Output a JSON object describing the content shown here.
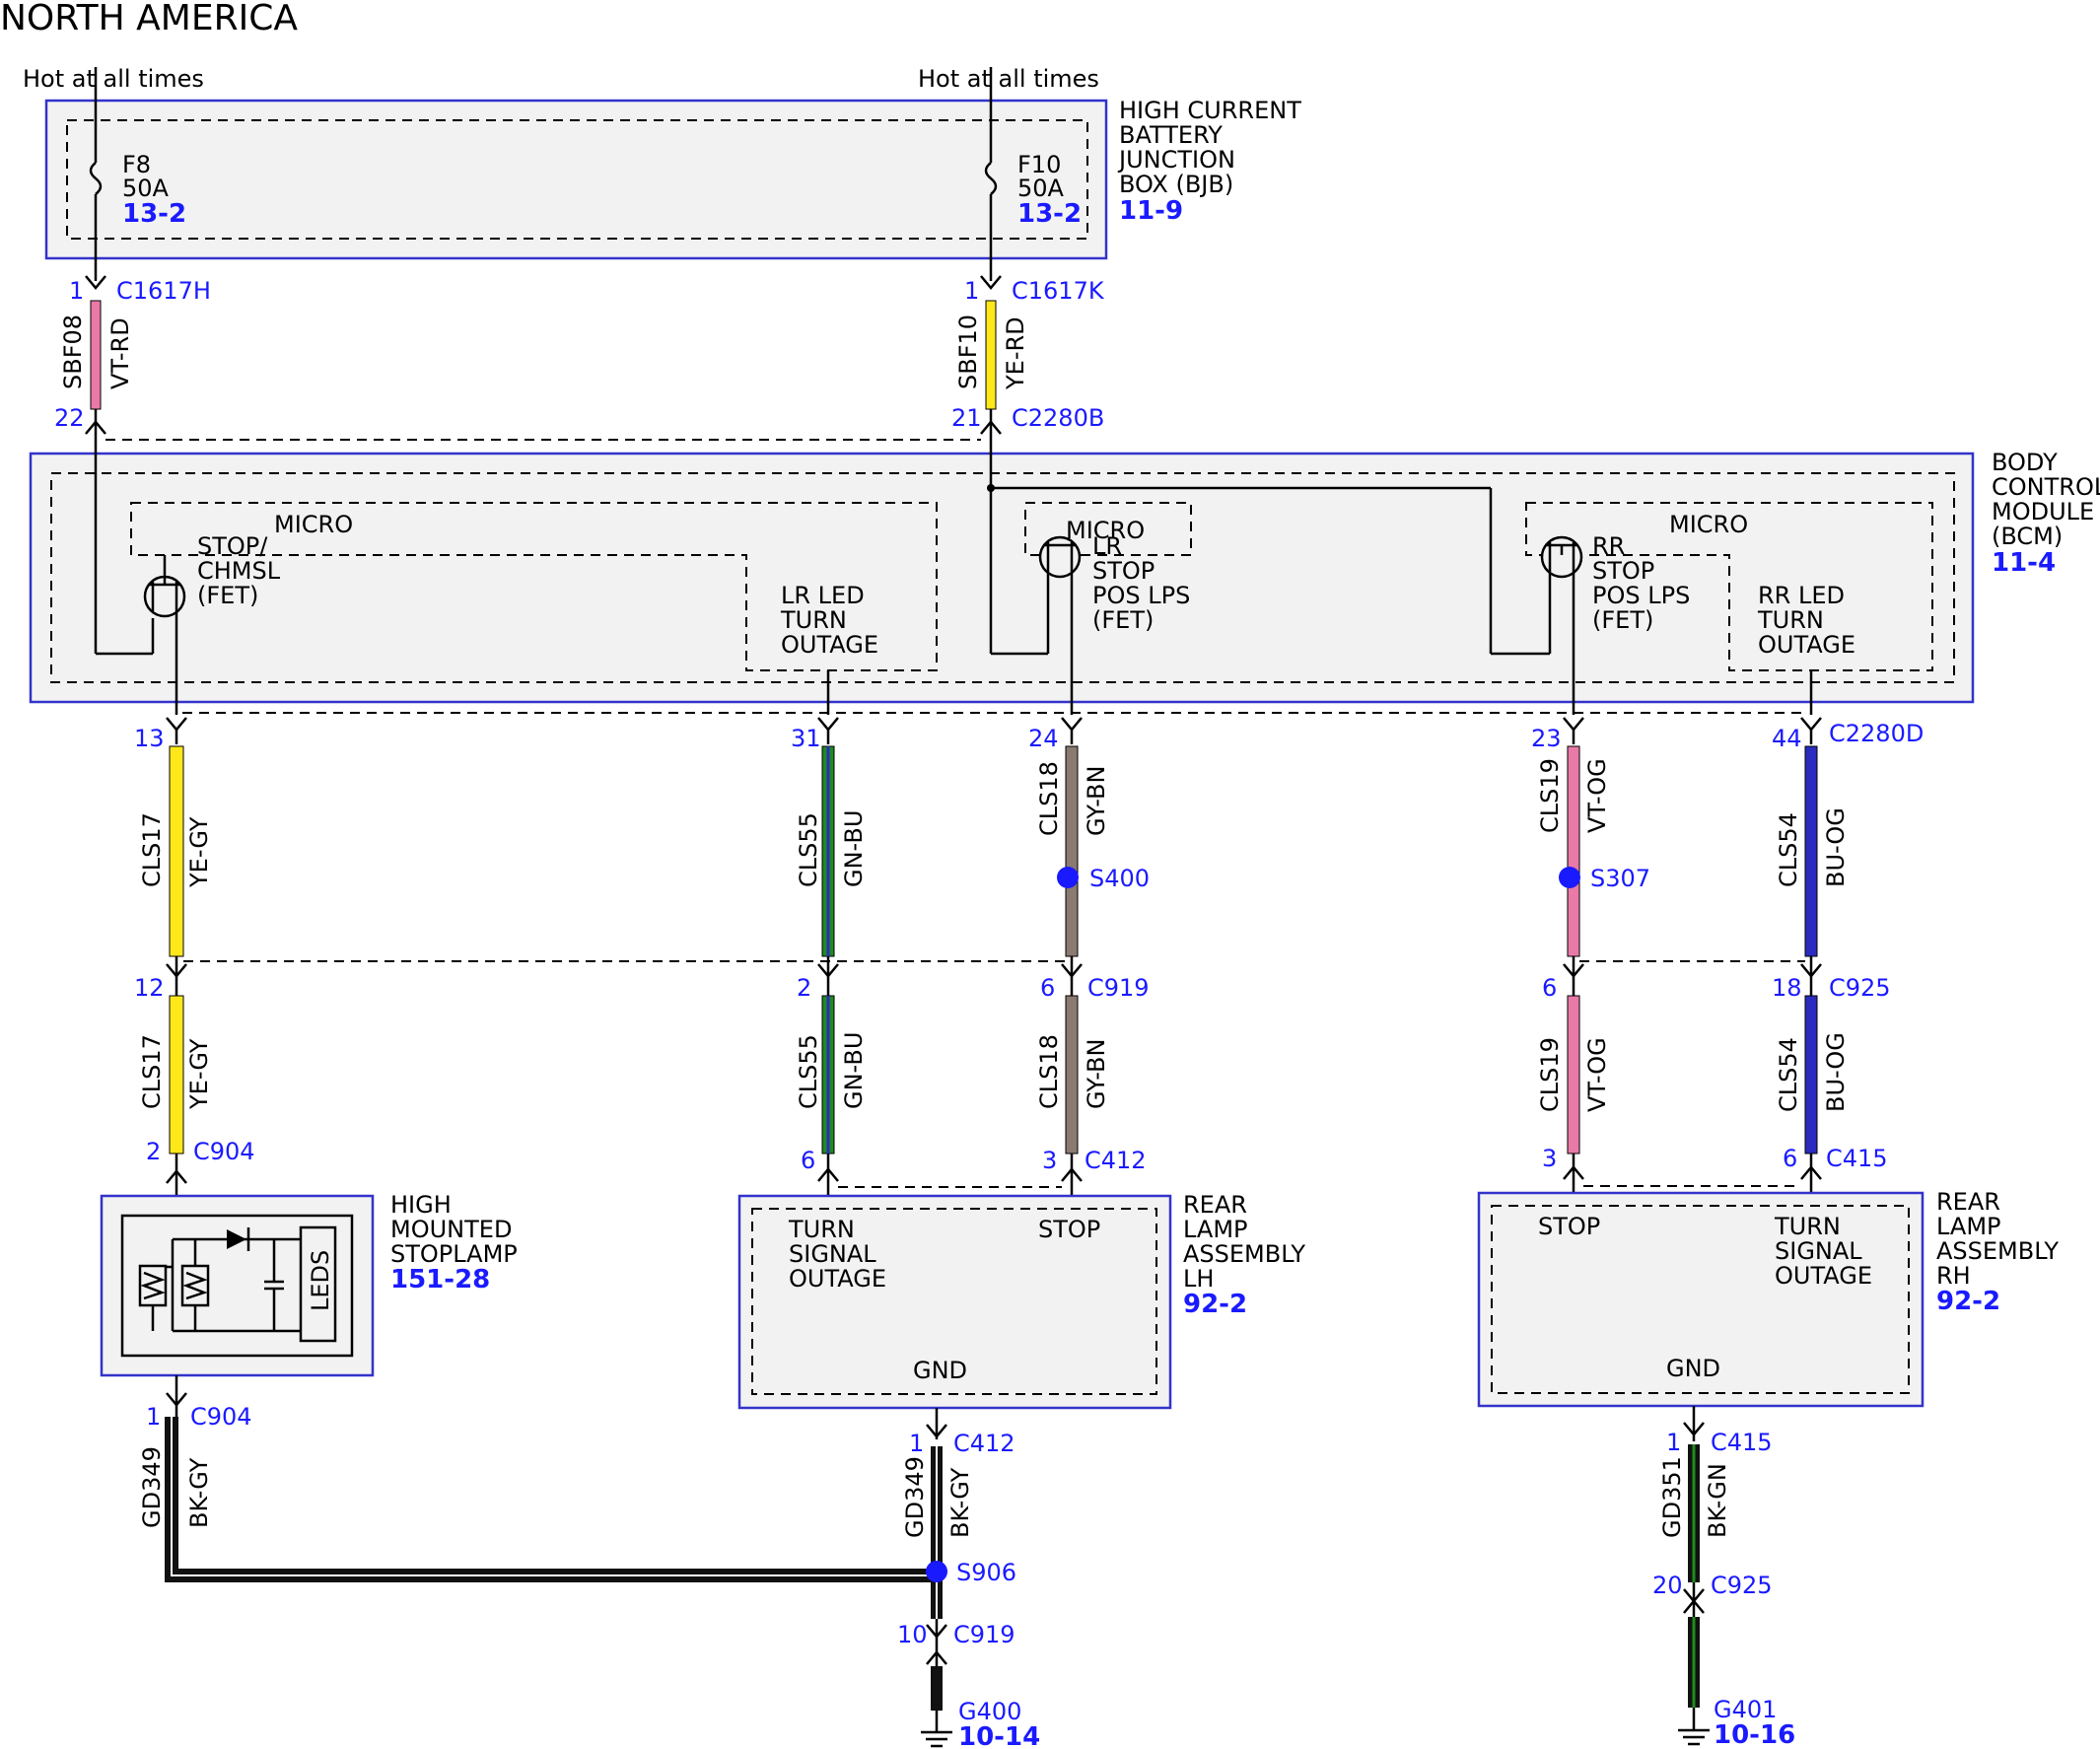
{
  "title": "NORTH AMERICA",
  "hot_labels": [
    "Hot at all times",
    "Hot at all times"
  ],
  "bjb": {
    "lines": [
      "HIGH CURRENT",
      "BATTERY",
      "JUNCTION",
      "BOX (BJB)"
    ],
    "ref": "11-9",
    "fuses": [
      {
        "name": "F8",
        "rating": "50A",
        "ref": "13-2"
      },
      {
        "name": "F10",
        "rating": "50A",
        "ref": "13-2"
      }
    ]
  },
  "bcm": {
    "lines": [
      "BODY",
      "CONTROL",
      "MODULE",
      "(BCM)"
    ],
    "ref": "11-4",
    "micro": "MICRO",
    "labels": {
      "stop_chmsl": [
        "STOP/",
        "CHMSL",
        "(FET)"
      ],
      "lr_led": [
        "LR LED",
        "TURN",
        "OUTAGE"
      ],
      "lr_stop": [
        "LR",
        "STOP",
        "POS LPS",
        "(FET)"
      ],
      "rr_stop": [
        "RR",
        "STOP",
        "POS LPS",
        "(FET)"
      ],
      "rr_led": [
        "RR LED",
        "TURN",
        "OUTAGE"
      ]
    }
  },
  "hmsl": {
    "lines": [
      "HIGH",
      "MOUNTED",
      "STOPLAMP"
    ],
    "ref": "151-28",
    "leds": "LEDS"
  },
  "rear_lh": {
    "lines": [
      "REAR",
      "LAMP",
      "ASSEMBLY",
      "LH"
    ],
    "ref": "92-2",
    "turn": [
      "TURN",
      "SIGNAL",
      "OUTAGE"
    ],
    "stop": "STOP",
    "gnd": "GND"
  },
  "rear_rh": {
    "lines": [
      "REAR",
      "LAMP",
      "ASSEMBLY",
      "RH"
    ],
    "ref": "92-2",
    "turn": [
      "TURN",
      "SIGNAL",
      "OUTAGE"
    ],
    "stop": "STOP",
    "gnd": "GND"
  },
  "pins": {
    "p1a": "1",
    "c1617h": "C1617H",
    "p1b": "1",
    "c1617k": "C1617K",
    "p22": "22",
    "p21": "21",
    "c2280b": "C2280B",
    "p13": "13",
    "p31": "31",
    "p24": "24",
    "p23": "23",
    "p44": "44",
    "c2280d": "C2280D",
    "p12": "12",
    "p2": "2",
    "p6a": "6",
    "c919": "C919",
    "p6b": "6",
    "p18": "18",
    "c925": "C925",
    "p2b": "2",
    "c904a": "C904",
    "p6c": "6",
    "p3a": "3",
    "c412a": "C412",
    "p3b": "3",
    "p6d": "6",
    "c415a": "C415",
    "p1c": "1",
    "c904b": "C904",
    "p1d": "1",
    "c412b": "C412",
    "p1e": "1",
    "c415b": "C415",
    "p10": "10",
    "c919b": "C919",
    "p20": "20",
    "c925b": "C925"
  },
  "wires": {
    "sbf08": {
      "circuit": "SBF08",
      "color": "VT-RD"
    },
    "sbf10": {
      "circuit": "SBF10",
      "color": "YE-RD"
    },
    "cls17a": {
      "circuit": "CLS17",
      "color": "YE-GY"
    },
    "cls17b": {
      "circuit": "CLS17",
      "color": "YE-GY"
    },
    "cls55a": {
      "circuit": "CLS55",
      "color": "GN-BU"
    },
    "cls55b": {
      "circuit": "CLS55",
      "color": "GN-BU"
    },
    "cls18a": {
      "circuit": "CLS18",
      "color": "GY-BN"
    },
    "cls18b": {
      "circuit": "CLS18",
      "color": "GY-BN"
    },
    "cls19a": {
      "circuit": "CLS19",
      "color": "VT-OG"
    },
    "cls19b": {
      "circuit": "CLS19",
      "color": "VT-OG"
    },
    "cls54a": {
      "circuit": "CLS54",
      "color": "BU-OG"
    },
    "cls54b": {
      "circuit": "CLS54",
      "color": "BU-OG"
    },
    "gd349a": {
      "circuit": "GD349",
      "color": "BK-GY"
    },
    "gd349b": {
      "circuit": "GD349",
      "color": "BK-GY"
    },
    "gd351": {
      "circuit": "GD351",
      "color": "BK-GN"
    }
  },
  "splices": {
    "s400": "S400",
    "s307": "S307",
    "s906": "S906"
  },
  "grounds": {
    "g400": "G400",
    "g400_ref": "10-14",
    "g401": "G401",
    "g401_ref": "10-16"
  },
  "colors": {
    "vt": "#e97aa8",
    "ye": "#ffe81a",
    "gn": "#1f8a1f",
    "bu": "#2b2bbf",
    "gy": "#8a7a70",
    "bk": "#111111",
    "border": "#3333cc",
    "ref": "#1a1aff"
  }
}
